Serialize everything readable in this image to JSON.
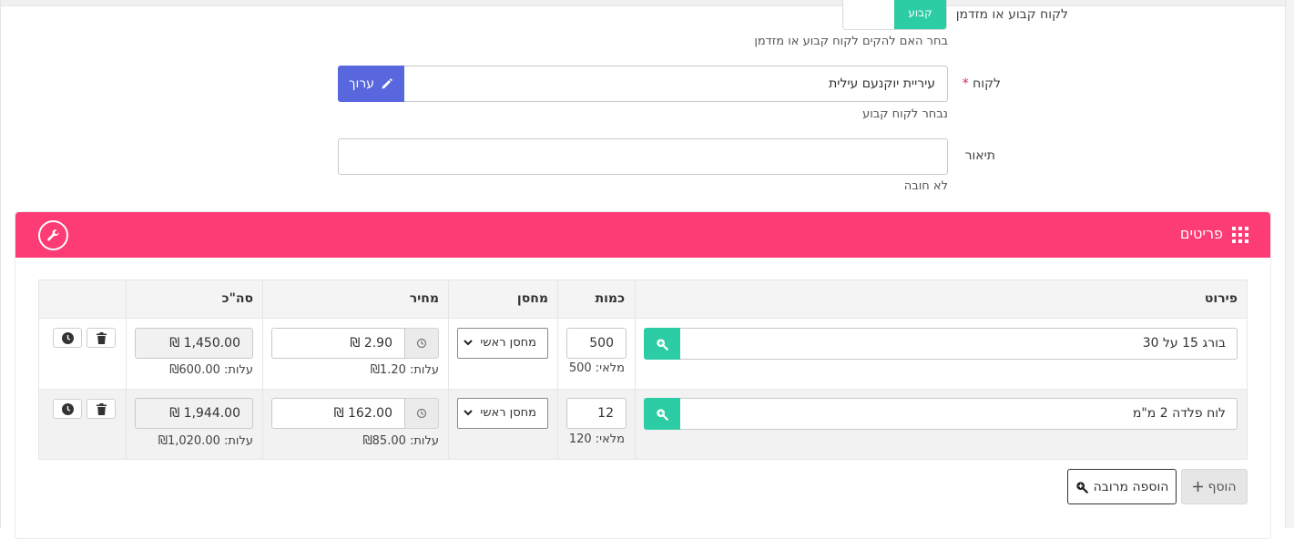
{
  "form": {
    "customer_type": {
      "label": "לקוח קבוע או מזדמן",
      "toggle_value": "קבוע",
      "help": "בחר האם להקים לקוח קבוע או מזדמן"
    },
    "customer": {
      "label": "לקוח",
      "required_mark": "*",
      "value": "עיריית יוקנעם עילית",
      "edit_label": "ערוך",
      "help": "נבחר לקוח קבוע"
    },
    "description": {
      "label": "תיאור",
      "value": "",
      "help": "לא חובה"
    }
  },
  "items_card": {
    "title": "פריטים",
    "colors": {
      "header": "#fd3c76",
      "search_button": "#2ccda4",
      "edit_button": "#5867dd"
    },
    "columns": {
      "item": "פירוט",
      "quantity": "כמות",
      "warehouse": "מחסן",
      "price": "מחיר",
      "total": "סה\"כ"
    },
    "rows": [
      {
        "item": "בורג 15 על 30",
        "quantity": "500",
        "stock_note": "מלאי: 500",
        "warehouse": "מחסן ראשי",
        "price": "2.90 ₪",
        "cost_note": "עלות: ₪1.20",
        "total": "1,450.00 ₪",
        "total_cost_note": "עלות: ₪600.00"
      },
      {
        "item": "לוח פלדה 2 מ\"מ",
        "quantity": "12",
        "stock_note": "מלאי: 120",
        "warehouse": "מחסן ראשי",
        "price": "162.00 ₪",
        "cost_note": "עלות: ₪85.00",
        "total": "1,944.00 ₪",
        "total_cost_note": "עלות: ₪1,020.00"
      }
    ],
    "add_label": "הוסף",
    "bulk_add_label": "הוספה מרובה"
  }
}
